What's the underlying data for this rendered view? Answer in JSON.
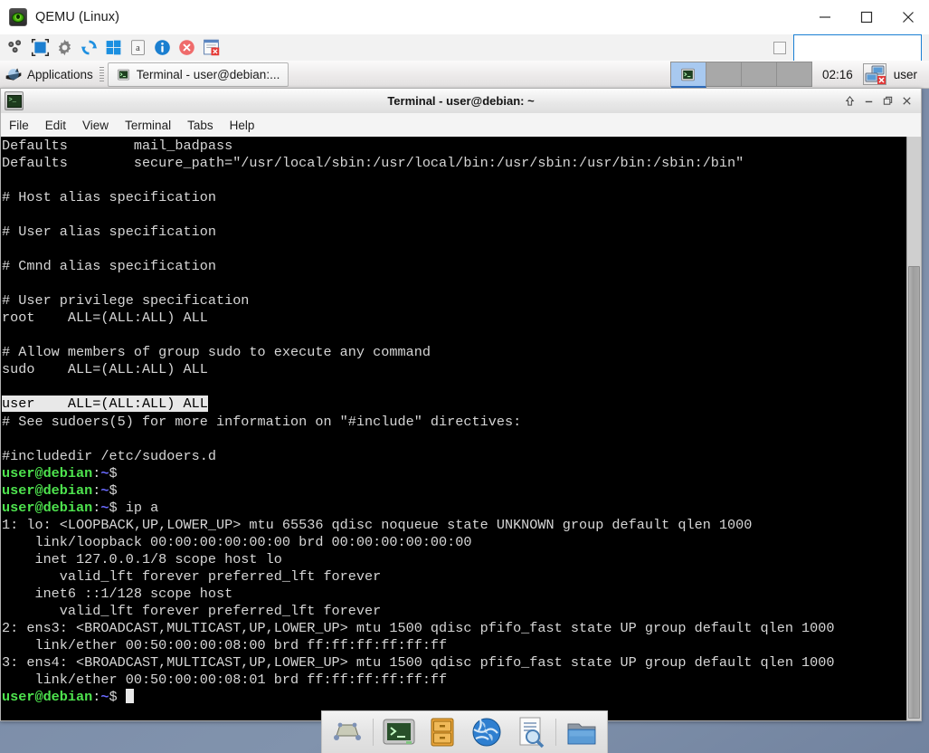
{
  "host_window": {
    "title": "QEMU (Linux)",
    "app_icon": "qemu-eye-icon",
    "controls": [
      {
        "name": "minimize-button",
        "icon": "minimize-icon"
      },
      {
        "name": "maximize-button",
        "icon": "maximize-icon"
      },
      {
        "name": "close-button",
        "icon": "close-icon"
      }
    ],
    "toolbar": {
      "icons": [
        {
          "name": "machine-icon",
          "label": "Machine"
        },
        {
          "name": "fullscreen-icon",
          "label": "Fullscreen"
        },
        {
          "name": "settings-gear-icon",
          "label": "Settings"
        },
        {
          "name": "reset-refresh-icon",
          "label": "Reset"
        },
        {
          "name": "windows-logo-icon",
          "label": "Send Key"
        },
        {
          "name": "screenshot-icon",
          "label": "Screenshot"
        },
        {
          "name": "info-icon",
          "label": "Info"
        },
        {
          "name": "stop-error-icon",
          "label": "Stop"
        },
        {
          "name": "snapshot-icon",
          "label": "Snapshot"
        }
      ],
      "checkbox_checked": false,
      "input_value": "",
      "input_placeholder": ""
    }
  },
  "guest_panel": {
    "applications_label": "Applications",
    "applications_icon": "xfce-mouse-icon",
    "task_button": {
      "label": "Terminal - user@debian:...",
      "icon": "terminal-icon"
    },
    "workspaces": [
      {
        "name": "workspace-1",
        "active": true,
        "icon": "terminal-icon"
      },
      {
        "name": "workspace-2",
        "active": false
      },
      {
        "name": "workspace-3",
        "active": false
      },
      {
        "name": "workspace-4",
        "active": false
      }
    ],
    "clock": "02:16",
    "network_icon": "network-disconnected-icon",
    "user_label": "user"
  },
  "terminal_window": {
    "title": "Terminal - user@debian: ~",
    "icon": "terminal-icon",
    "title_buttons": [
      {
        "name": "shade-button",
        "icon": "shade-up-icon"
      },
      {
        "name": "minimize-button",
        "icon": "minimize-icon"
      },
      {
        "name": "maximize-button",
        "icon": "maximize-icon"
      },
      {
        "name": "close-button",
        "icon": "close-icon"
      }
    ],
    "menu": [
      "File",
      "Edit",
      "View",
      "Terminal",
      "Tabs",
      "Help"
    ],
    "colors": {
      "background": "#000000",
      "foreground": "#d6d6d6",
      "prompt_user_host": "#4ee44e",
      "prompt_path": "#6a6aff",
      "selection_bg": "#e8e8e8"
    },
    "lines": [
      [
        {
          "t": "Defaults        mail_badpass"
        }
      ],
      [
        {
          "t": "Defaults        secure_path=\"/usr/local/sbin:/usr/local/bin:/usr/sbin:/usr/bin:/sbin:/bin\""
        }
      ],
      [
        {
          "t": ""
        }
      ],
      [
        {
          "t": "# Host alias specification"
        }
      ],
      [
        {
          "t": ""
        }
      ],
      [
        {
          "t": "# User alias specification"
        }
      ],
      [
        {
          "t": ""
        }
      ],
      [
        {
          "t": "# Cmnd alias specification"
        }
      ],
      [
        {
          "t": ""
        }
      ],
      [
        {
          "t": "# User privilege specification"
        }
      ],
      [
        {
          "t": "root    ALL=(ALL:ALL) ALL"
        }
      ],
      [
        {
          "t": ""
        }
      ],
      [
        {
          "t": "# Allow members of group sudo to execute any command"
        }
      ],
      [
        {
          "t": "sudo    ALL=(ALL:ALL) ALL"
        }
      ],
      [
        {
          "t": ""
        }
      ],
      [
        {
          "t": "user    ALL=(ALL:ALL) ALL",
          "c": "inv"
        }
      ],
      [
        {
          "t": "# See sudoers(5) for more information on \"#include\" directives:"
        }
      ],
      [
        {
          "t": ""
        }
      ],
      [
        {
          "t": "#includedir /etc/sudoers.d"
        }
      ],
      [
        {
          "t": "user@debian",
          "c": "c-green"
        },
        {
          "t": ":",
          "c": "c-white"
        },
        {
          "t": "~",
          "c": "c-blue"
        },
        {
          "t": "$",
          "c": "c-white"
        }
      ],
      [
        {
          "t": "user@debian",
          "c": "c-green"
        },
        {
          "t": ":",
          "c": "c-white"
        },
        {
          "t": "~",
          "c": "c-blue"
        },
        {
          "t": "$",
          "c": "c-white"
        }
      ],
      [
        {
          "t": "user@debian",
          "c": "c-green"
        },
        {
          "t": ":",
          "c": "c-white"
        },
        {
          "t": "~",
          "c": "c-blue"
        },
        {
          "t": "$ ip a",
          "c": "c-white"
        }
      ],
      [
        {
          "t": "1: lo: <LOOPBACK,UP,LOWER_UP> mtu 65536 qdisc noqueue state UNKNOWN group default qlen 1000"
        }
      ],
      [
        {
          "t": "    link/loopback 00:00:00:00:00:00 brd 00:00:00:00:00:00"
        }
      ],
      [
        {
          "t": "    inet 127.0.0.1/8 scope host lo"
        }
      ],
      [
        {
          "t": "       valid_lft forever preferred_lft forever"
        }
      ],
      [
        {
          "t": "    inet6 ::1/128 scope host"
        }
      ],
      [
        {
          "t": "       valid_lft forever preferred_lft forever"
        }
      ],
      [
        {
          "t": "2: ens3: <BROADCAST,MULTICAST,UP,LOWER_UP> mtu 1500 qdisc pfifo_fast state UP group default qlen 1000"
        }
      ],
      [
        {
          "t": "    link/ether 00:50:00:00:08:00 brd ff:ff:ff:ff:ff:ff"
        }
      ],
      [
        {
          "t": "3: ens4: <BROADCAST,MULTICAST,UP,LOWER_UP> mtu 1500 qdisc pfifo_fast state UP group default qlen 1000"
        }
      ],
      [
        {
          "t": "    link/ether 00:50:00:00:08:01 brd ff:ff:ff:ff:ff:ff"
        }
      ],
      [
        {
          "t": "user@debian",
          "c": "c-green"
        },
        {
          "t": ":",
          "c": "c-white"
        },
        {
          "t": "~",
          "c": "c-blue"
        },
        {
          "t": "$ ",
          "c": "c-white"
        },
        {
          "t": "",
          "c": "caret"
        }
      ]
    ]
  },
  "dock": {
    "items": [
      {
        "name": "show-desktop-icon",
        "label": "Show Desktop"
      },
      {
        "name": "terminal-icon",
        "label": "Terminal Emulator"
      },
      {
        "name": "file-archiver-icon",
        "label": "Archive Manager"
      },
      {
        "name": "web-browser-icon",
        "label": "Web Browser"
      },
      {
        "name": "find-files-icon",
        "label": "Find Files"
      },
      {
        "name": "file-manager-icon",
        "label": "File Manager"
      }
    ]
  }
}
